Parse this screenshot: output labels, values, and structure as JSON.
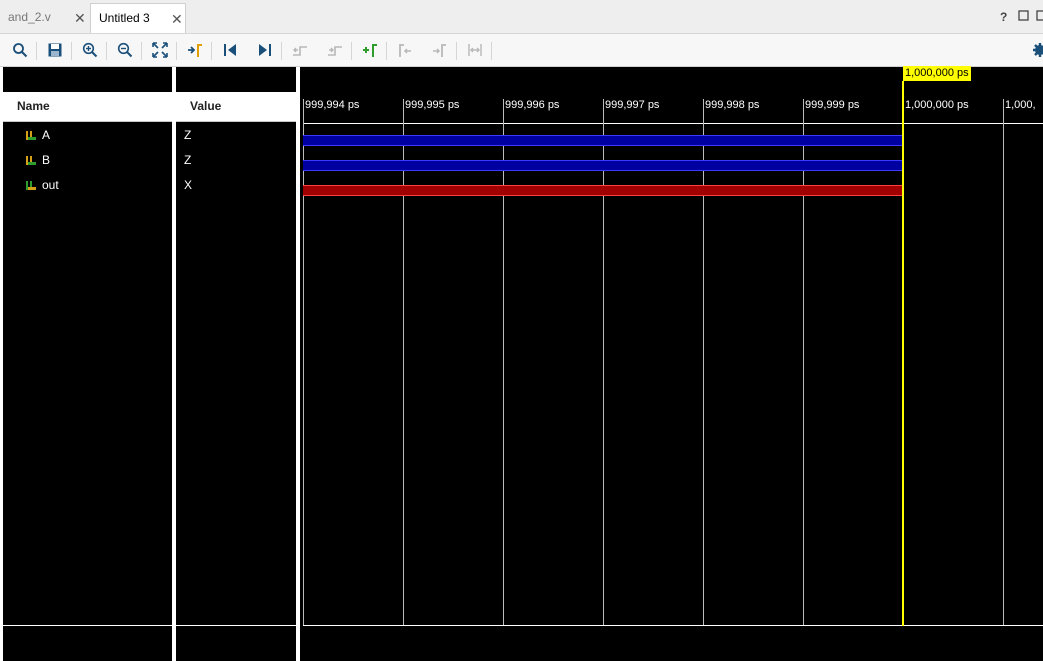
{
  "tabs": [
    {
      "label": "and_2.v",
      "active": false
    },
    {
      "label": "Untitled 3",
      "active": true
    }
  ],
  "window_controls": {
    "help": "?"
  },
  "toolbar": {
    "icons": [
      "search-icon",
      "save-icon",
      "zoom-in-icon",
      "zoom-out-icon",
      "zoom-fit-icon",
      "go-to-cursor-icon",
      "go-to-start-icon",
      "go-to-end-icon",
      "previous-transition-icon",
      "next-transition-icon",
      "add-marker-icon",
      "previous-marker-icon",
      "next-marker-icon",
      "swap-cursors-icon",
      "settings-icon"
    ]
  },
  "columns": {
    "name": "Name",
    "value": "Value"
  },
  "signals": [
    {
      "name": "A",
      "value": "Z",
      "state": "z"
    },
    {
      "name": "B",
      "value": "Z",
      "state": "z"
    },
    {
      "name": "out",
      "value": "X",
      "state": "x"
    }
  ],
  "timeline": {
    "ticks": [
      "999,994 ps",
      "999,995 ps",
      "999,996 ps",
      "999,997 ps",
      "999,998 ps",
      "999,999 ps",
      "1,000,000 ps",
      "1,000,"
    ],
    "cursor_label": "1,000,000 ps"
  },
  "colors": {
    "z_wave": "#0000a0",
    "x_wave": "#c00000",
    "cursor": "#ffff00",
    "grid": "#bbbbbb"
  }
}
